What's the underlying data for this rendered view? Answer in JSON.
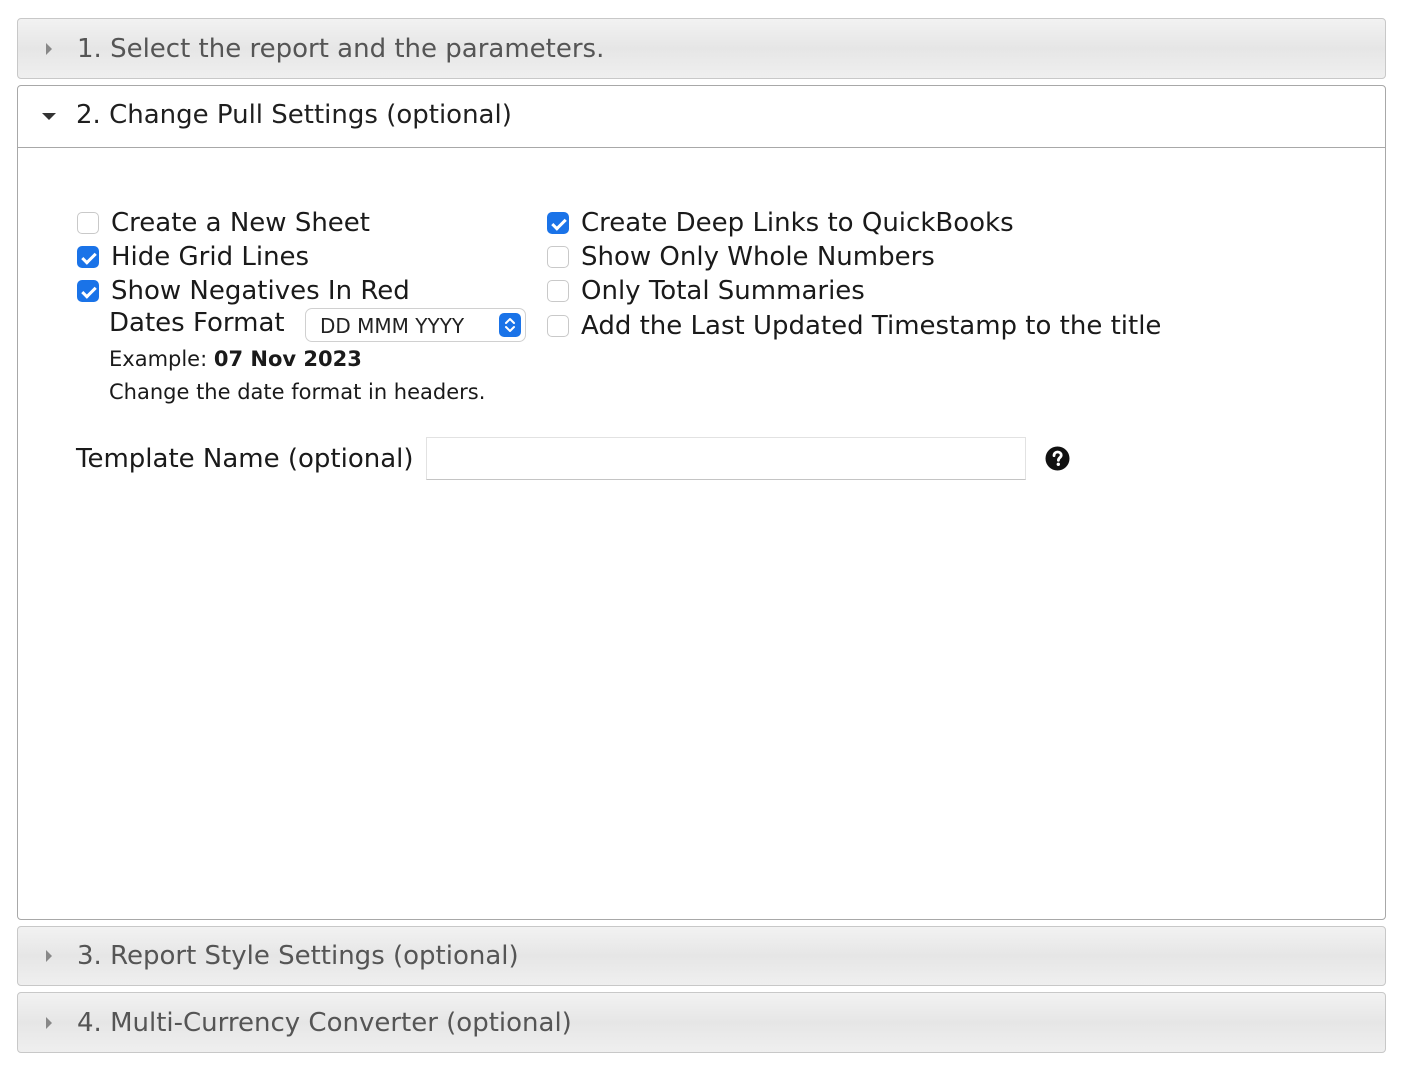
{
  "sections": {
    "s1": {
      "label": "1. Select the report and the parameters."
    },
    "s2": {
      "label": "2. Change Pull Settings (optional)"
    },
    "s3": {
      "label": "3. Report Style Settings (optional)"
    },
    "s4": {
      "label": "4. Multi-Currency Converter (optional)"
    }
  },
  "options": {
    "create_new_sheet": {
      "label": "Create a New Sheet",
      "checked": false
    },
    "hide_grid_lines": {
      "label": "Hide Grid Lines",
      "checked": true
    },
    "show_negatives_red": {
      "label": "Show Negatives In Red",
      "checked": true
    },
    "deep_links": {
      "label": "Create Deep Links to QuickBooks",
      "checked": true
    },
    "whole_numbers": {
      "label": "Show Only Whole Numbers",
      "checked": false
    },
    "total_summaries": {
      "label": "Only Total Summaries",
      "checked": false
    },
    "last_updated": {
      "label": "Add the Last Updated Timestamp to the title",
      "checked": false
    }
  },
  "dates": {
    "label": "Dates Format",
    "selected": "DD MMM YYYY",
    "example_prefix": "Example:",
    "example_value": "07 Nov 2023",
    "hint": "Change the date format in headers."
  },
  "template": {
    "label": "Template Name (optional)",
    "value": ""
  },
  "colors": {
    "accent": "#1a73e8"
  },
  "icons": {
    "help": "question-circle-icon"
  }
}
